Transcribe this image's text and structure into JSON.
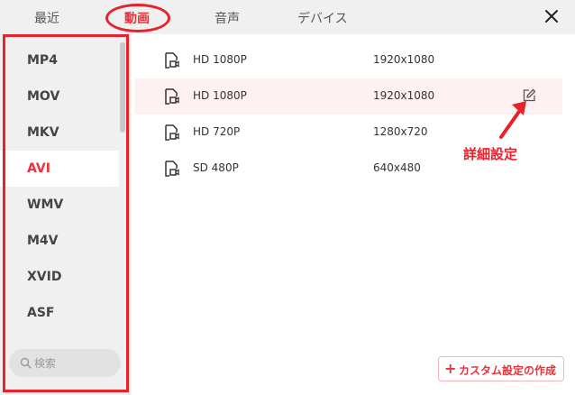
{
  "tabs": [
    {
      "label": "最近"
    },
    {
      "label": "動画"
    },
    {
      "label": "音声"
    },
    {
      "label": "デバイス"
    }
  ],
  "sidebar": {
    "items": [
      {
        "label": "MP4"
      },
      {
        "label": "MOV"
      },
      {
        "label": "MKV"
      },
      {
        "label": "AVI"
      },
      {
        "label": "WMV"
      },
      {
        "label": "M4V"
      },
      {
        "label": "XVID"
      },
      {
        "label": "ASF"
      }
    ],
    "active_item": "AVI",
    "search_placeholder": "検索"
  },
  "presets": [
    {
      "name": "HD 1080P",
      "resolution": "1920x1080",
      "icon": "video-file-icon"
    },
    {
      "name": "HD 1080P",
      "resolution": "1920x1080",
      "icon": "video-file-icon"
    },
    {
      "name": "HD 720P",
      "resolution": "1280x720",
      "icon": "video-file-icon"
    },
    {
      "name": "SD 480P",
      "resolution": "640x480",
      "icon": "video-file-icon"
    }
  ],
  "annotation": {
    "label": "詳細設定"
  },
  "custom_button": {
    "plus": "+",
    "label": "カスタム設定の作成"
  },
  "colors": {
    "accent": "#e8323c",
    "annotation": "#e8212b",
    "hover_row": "#fdf1f1"
  }
}
